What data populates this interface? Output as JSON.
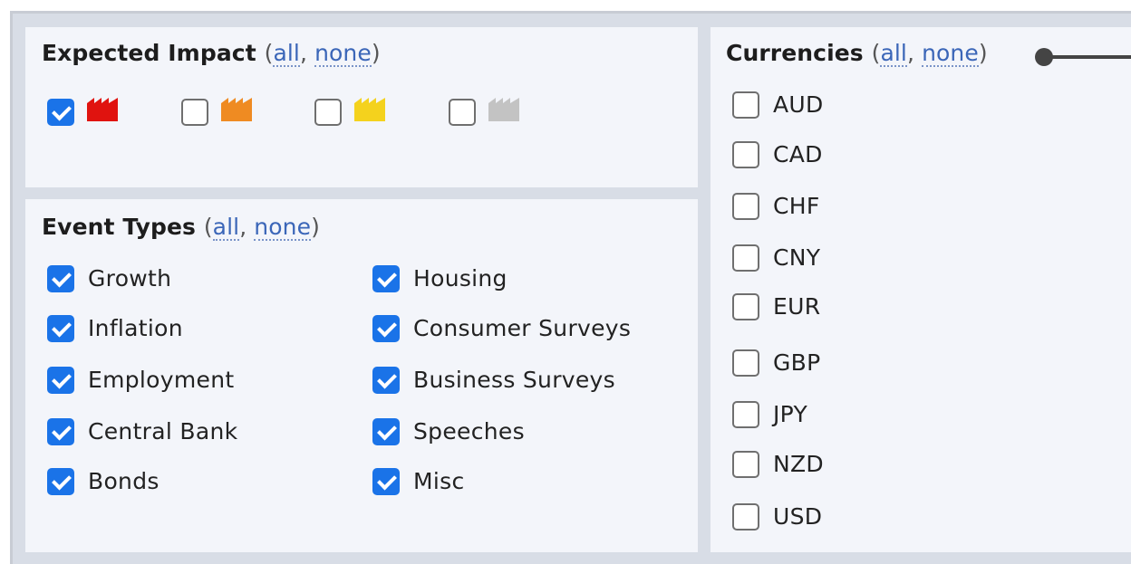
{
  "impact": {
    "title": "Expected Impact",
    "all": "all",
    "none": "none",
    "levels": [
      {
        "icon": "red-factory-icon",
        "color": "#e0130f",
        "checked": true
      },
      {
        "icon": "orange-factory-icon",
        "color": "#ef8b22",
        "checked": false
      },
      {
        "icon": "yellow-factory-icon",
        "color": "#f4d21d",
        "checked": false
      },
      {
        "icon": "gray-factory-icon",
        "color": "#c3c3c3",
        "checked": false
      }
    ]
  },
  "event_types": {
    "title": "Event Types",
    "all": "all",
    "none": "none",
    "items": [
      {
        "label": "Growth",
        "checked": true
      },
      {
        "label": "Inflation",
        "checked": true
      },
      {
        "label": "Employment",
        "checked": true
      },
      {
        "label": "Central Bank",
        "checked": true
      },
      {
        "label": "Bonds",
        "checked": true
      },
      {
        "label": "Housing",
        "checked": true
      },
      {
        "label": "Consumer Surveys",
        "checked": true
      },
      {
        "label": "Business Surveys",
        "checked": true
      },
      {
        "label": "Speeches",
        "checked": true
      },
      {
        "label": "Misc",
        "checked": true
      }
    ]
  },
  "currencies": {
    "title": "Currencies",
    "all": "all",
    "none": "none",
    "items": [
      {
        "label": "AUD",
        "checked": false
      },
      {
        "label": "CAD",
        "checked": false
      },
      {
        "label": "CHF",
        "checked": false
      },
      {
        "label": "CNY",
        "checked": false
      },
      {
        "label": "EUR",
        "checked": false
      },
      {
        "label": "GBP",
        "checked": false
      },
      {
        "label": "JPY",
        "checked": false
      },
      {
        "label": "NZD",
        "checked": false
      },
      {
        "label": "USD",
        "checked": false
      }
    ]
  },
  "colors": {
    "accent": "#1a73e8",
    "link": "#3b66b8",
    "panel_bg": "#f3f5fa"
  }
}
